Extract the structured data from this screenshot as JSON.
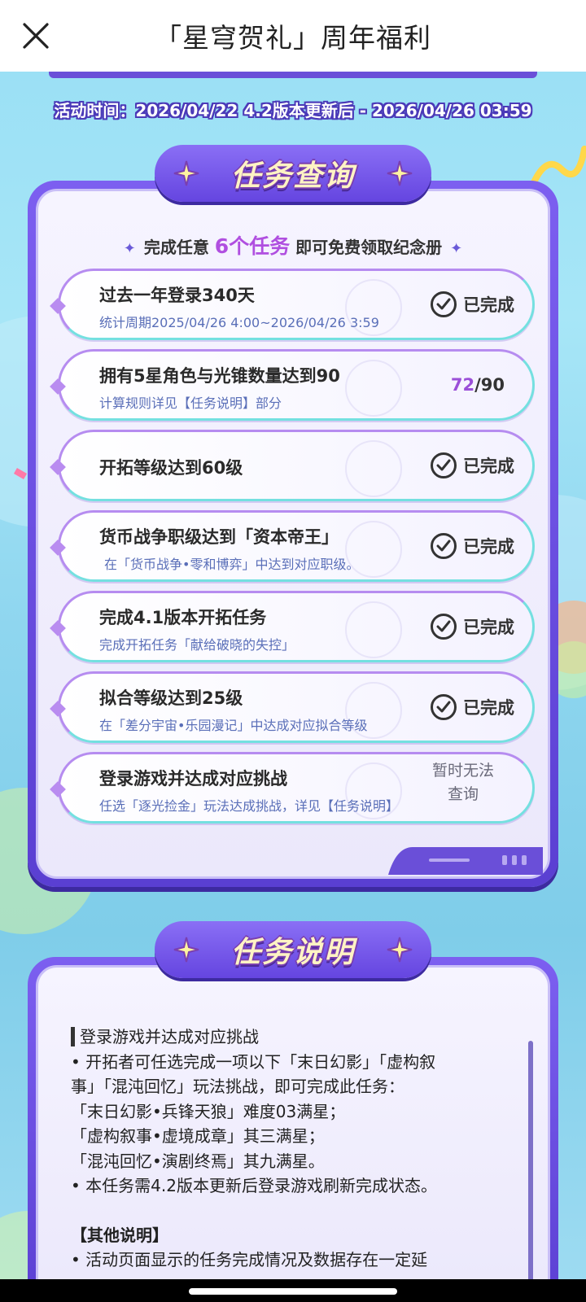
{
  "header": {
    "title": "「星穹贺礼」周年福利"
  },
  "activity": {
    "time": "活动时间：2026/04/22 4.2版本更新后 - 2026/04/26 03:59"
  },
  "query_panel": {
    "banner": "任务查询",
    "intro_prefix": "完成任意",
    "intro_highlight": "6个任务",
    "intro_suffix": "即可免费领取纪念册",
    "spark": "✦",
    "tasks": [
      {
        "title": "过去一年登录340天",
        "sub": "统计周期2025/04/26 4:00~2026/04/26 3:59",
        "status": "已完成"
      },
      {
        "title": "拥有5星角色与光锥数量达到90",
        "sub": "计算规则详见【任务说明】部分",
        "progress_current": "72",
        "progress_total": "/90"
      },
      {
        "title": "开拓等级达到60级",
        "sub": "",
        "status": "已完成"
      },
      {
        "title": "货币战争职级达到「资本帝王」",
        "sub": "在「货币战争•零和博弈」中达到对应职级。",
        "status": "已完成"
      },
      {
        "title": "完成4.1版本开拓任务",
        "sub": "完成开拓任务「献给破晓的失控」",
        "status": "已完成"
      },
      {
        "title": "拟合等级达到25级",
        "sub": "在「差分宇宙•乐园漫记」中达成对应拟合等级",
        "status": "已完成"
      },
      {
        "title": "登录游戏并达成对应挑战",
        "sub": "任选「逐光捡金」玩法达成挑战，详见【任务说明】",
        "status_line1": "暂时无法",
        "status_line2": "查询"
      }
    ]
  },
  "desc_panel": {
    "banner": "任务说明",
    "section_title": "登录游戏并达成对应挑战",
    "lines": [
      "• 开拓者可任选完成一项以下「末日幻影」「虚构叙",
      "事」「混沌回忆」玩法挑战，即可完成此任务：",
      "「末日幻影•兵锋天狼」难度03满星；",
      "「虚构叙事•虚境成章」其三满星；",
      "「混沌回忆•演剧终焉」其九满星。",
      "• 本任务需4.2版本更新后登录游戏刷新完成状态。"
    ],
    "other_title": "【其他说明】",
    "other_line": "• 活动页面显示的任务完成情况及数据存在一定延"
  },
  "colors": {
    "accent": "#6a4fd8",
    "highlight": "#b04fe0",
    "teal": "#74e0e0"
  }
}
